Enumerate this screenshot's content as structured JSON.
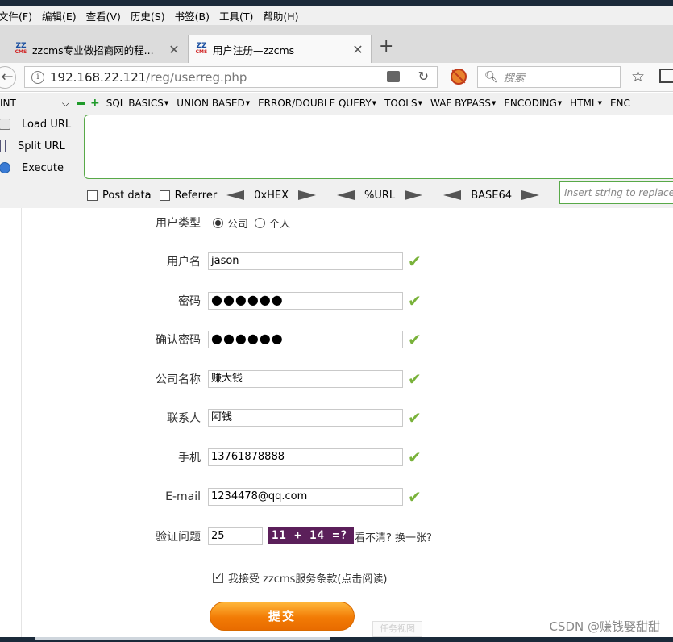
{
  "menubar": {
    "items": [
      "文件(F)",
      "编辑(E)",
      "查看(V)",
      "历史(S)",
      "书签(B)",
      "工具(T)",
      "帮助(H)"
    ]
  },
  "tabs": [
    {
      "label": "zzcms专业做招商网的程...",
      "favicon_top": "ZZ",
      "favicon_bottom": "CMS",
      "active": false
    },
    {
      "label": "用户注册—zzcms",
      "favicon_top": "ZZ",
      "favicon_bottom": "CMS",
      "active": true
    }
  ],
  "tab_close": "✕",
  "new_tab": "+",
  "nav": {
    "url_host": "192.168.22.121",
    "url_path": "/reg/userreg.php",
    "search_placeholder": "搜索"
  },
  "hackbar": {
    "select_value": "INT",
    "menu": [
      "SQL BASICS",
      "UNION BASED",
      "ERROR/DOUBLE QUERY",
      "TOOLS",
      "WAF BYPASS",
      "ENCODING",
      "HTML",
      "ENC"
    ],
    "actions": [
      "Load URL",
      "Split URL",
      "Execute"
    ],
    "post_data": "Post data",
    "referrer": "Referrer",
    "encoders": [
      "0xHEX",
      "%URL",
      "BASE64"
    ],
    "insert_placeholder": "Insert string to replace"
  },
  "form": {
    "user_type": {
      "label": "用户类型",
      "options": [
        "公司",
        "个人"
      ],
      "selected": "公司"
    },
    "username": {
      "label": "用户名",
      "value": "jason"
    },
    "password": {
      "label": "密码",
      "value": "●●●●●●"
    },
    "confirm_password": {
      "label": "确认密码",
      "value": "●●●●●●"
    },
    "company": {
      "label": "公司名称",
      "value": "赚大钱"
    },
    "contact": {
      "label": "联系人",
      "value": "阿钱"
    },
    "mobile": {
      "label": "手机",
      "value": "13761878888"
    },
    "email": {
      "label": "E-mail",
      "value": "1234478@qq.com"
    },
    "captcha": {
      "label": "验证问题",
      "value": "25",
      "question": "11 + 14 =?",
      "refresh": "看不清? 换一张?"
    },
    "agree_text": "我接受 zzcms服务条款(点击阅读)",
    "submit_label": "提交"
  },
  "taskview": "任务视图",
  "watermark": "CSDN @赚钱娶甜甜",
  "colors": {
    "accent_check": "#79b23a",
    "submit": "#f27b05",
    "hackbar_border": "#58a948",
    "captcha_bg": "#5b1f5a"
  }
}
